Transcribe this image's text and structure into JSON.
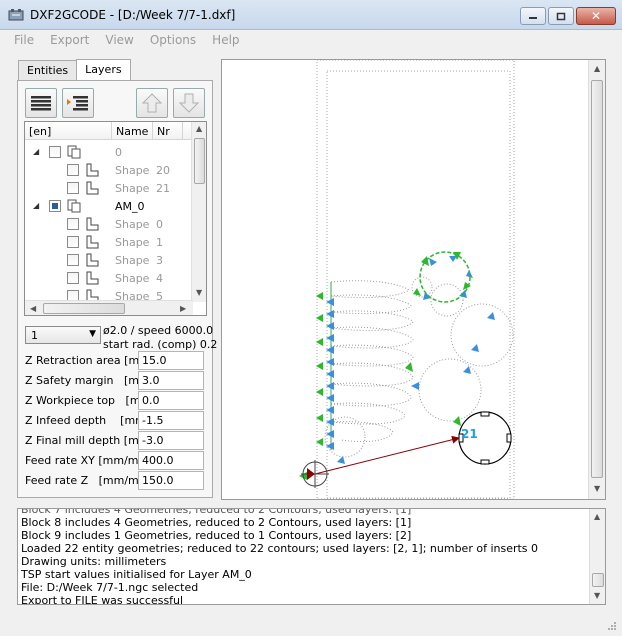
{
  "window": {
    "title": "DXF2GCODE - [D:/Week 7/7-1.dxf]"
  },
  "menu": [
    "File",
    "Export",
    "View",
    "Options",
    "Help"
  ],
  "tabs": [
    "Entities",
    "Layers"
  ],
  "tree": {
    "headers": [
      "[en]",
      "Name",
      "Nr"
    ],
    "rows": [
      {
        "name": "0",
        "nr": "",
        "level": 0,
        "checked": false
      },
      {
        "name": "Shape",
        "nr": "20",
        "level": 1,
        "checked": false
      },
      {
        "name": "Shape",
        "nr": "21",
        "level": 1,
        "checked": false
      },
      {
        "name": "AM_0",
        "nr": "",
        "level": 0,
        "checked": true
      },
      {
        "name": "Shape",
        "nr": "0",
        "level": 1,
        "checked": false
      },
      {
        "name": "Shape",
        "nr": "1",
        "level": 1,
        "checked": false
      },
      {
        "name": "Shape",
        "nr": "3",
        "level": 1,
        "checked": false
      },
      {
        "name": "Shape",
        "nr": "4",
        "level": 1,
        "checked": false
      },
      {
        "name": "Shape",
        "nr": "5",
        "level": 1,
        "checked": false
      }
    ]
  },
  "tool": {
    "selected": "1",
    "line1": "ø2.0 / speed 6000.0",
    "line2": "start rad. (comp) 0.2"
  },
  "params": [
    {
      "label": "Z Retraction area",
      "unit": "[mm]",
      "value": "15.0"
    },
    {
      "label": "Z Safety margin",
      "unit": "[mm]",
      "value": "3.0"
    },
    {
      "label": "Z Workpiece top",
      "unit": "[mm]",
      "value": "0.0"
    },
    {
      "label": "Z Infeed depth",
      "unit": "[mm]",
      "value": "-1.5"
    },
    {
      "label": "Z Final mill depth",
      "unit": "[mm]",
      "value": "-3.0"
    },
    {
      "label": "Feed rate XY",
      "unit": "[mm/min]",
      "value": "400.0"
    },
    {
      "label": "Feed rate Z",
      "unit": "[mm/min]",
      "value": "150.0"
    }
  ],
  "canvas": {
    "shape_label": "21"
  },
  "log": [
    "Block 8 includes 4 Geometries, reduced to 2 Contours, used layers: [1]",
    "Block 9 includes 1 Geometries, reduced to 1 Contours, used layers: [2]",
    "Loaded 22 entity geometries; reduced to 22 contours; used layers: [2, 1]; number of inserts 0",
    "Drawing units: millimeters",
    "TSP start values initialised for Layer AM_0",
    "File: D:/Week 7/7-1.ngc selected",
    "Export to FILE was successful"
  ],
  "colors": {
    "arrow": "#3b8fe0",
    "start": "#2db82d",
    "rapid": "#8b0000",
    "label": "#1ea0e6"
  }
}
